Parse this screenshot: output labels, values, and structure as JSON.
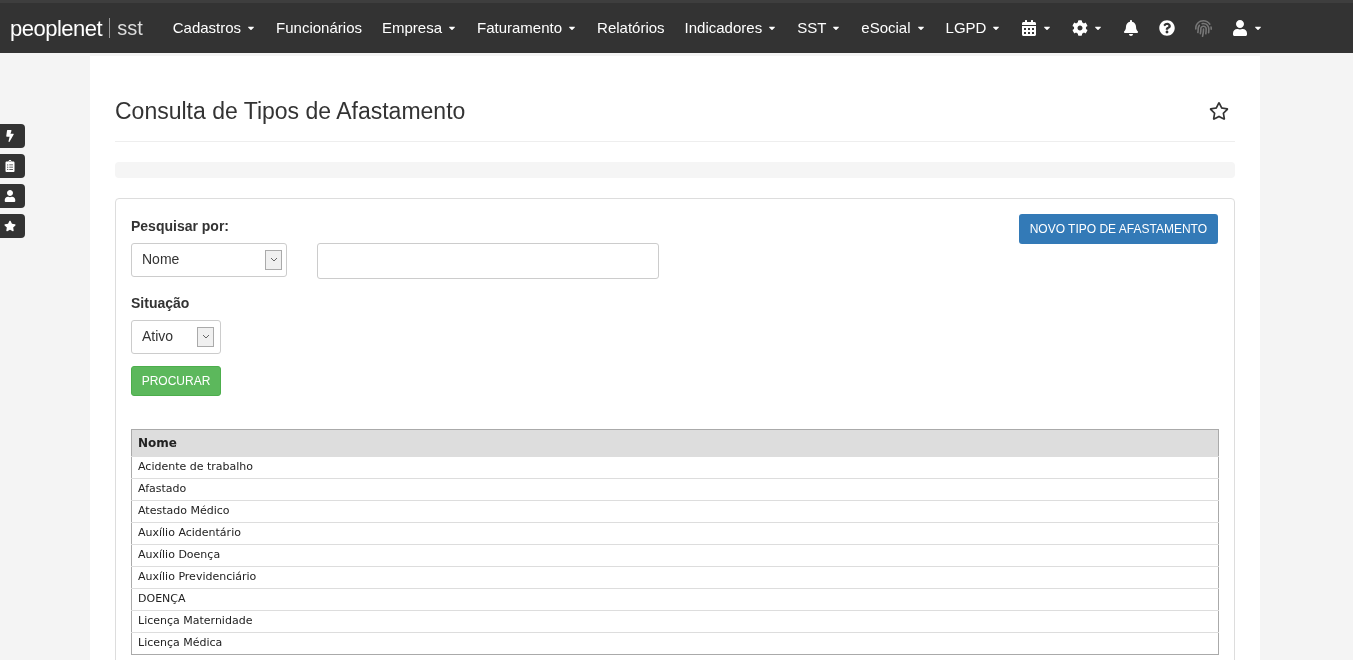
{
  "navbar": {
    "logo": {
      "brand": "peoplenet",
      "product": "sst"
    },
    "menus": [
      {
        "label": "Cadastros",
        "dropdown": true
      },
      {
        "label": "Funcionários",
        "dropdown": false
      },
      {
        "label": "Empresa",
        "dropdown": true
      },
      {
        "label": "Faturamento",
        "dropdown": true
      },
      {
        "label": "Relatórios",
        "dropdown": false
      },
      {
        "label": "Indicadores",
        "dropdown": true
      },
      {
        "label": "SST",
        "dropdown": true
      },
      {
        "label": "eSocial",
        "dropdown": true
      },
      {
        "label": "LGPD",
        "dropdown": true
      }
    ],
    "icon_menus": [
      {
        "kind": "calendar",
        "dropdown": true
      },
      {
        "kind": "settings",
        "dropdown": true
      },
      {
        "kind": "bell",
        "dropdown": false
      },
      {
        "kind": "help",
        "dropdown": false
      },
      {
        "kind": "fingerprint",
        "dropdown": false
      },
      {
        "kind": "user",
        "dropdown": true
      }
    ]
  },
  "side_shortcuts": [
    {
      "kind": "bolt"
    },
    {
      "kind": "clipboard"
    },
    {
      "kind": "user"
    },
    {
      "kind": "star"
    }
  ],
  "page": {
    "title": "Consulta de Tipos de Afastamento",
    "favorite": false
  },
  "search": {
    "search_by_label": "Pesquisar por:",
    "search_by_value": "Nome",
    "status_label": "Situação",
    "status_value": "Ativo",
    "search_button": "PROCURAR",
    "new_button": "NOVO TIPO DE AFASTAMENTO"
  },
  "table": {
    "columns": [
      "Nome"
    ],
    "rows": [
      [
        "Acidente de trabalho"
      ],
      [
        "Afastado"
      ],
      [
        "Atestado Médico"
      ],
      [
        "Auxílio Acidentário"
      ],
      [
        "Auxílio Doença"
      ],
      [
        "Auxílio Previdenciário"
      ],
      [
        "DOENÇA"
      ],
      [
        "Licença Maternidade"
      ],
      [
        "Licença Médica"
      ]
    ]
  }
}
